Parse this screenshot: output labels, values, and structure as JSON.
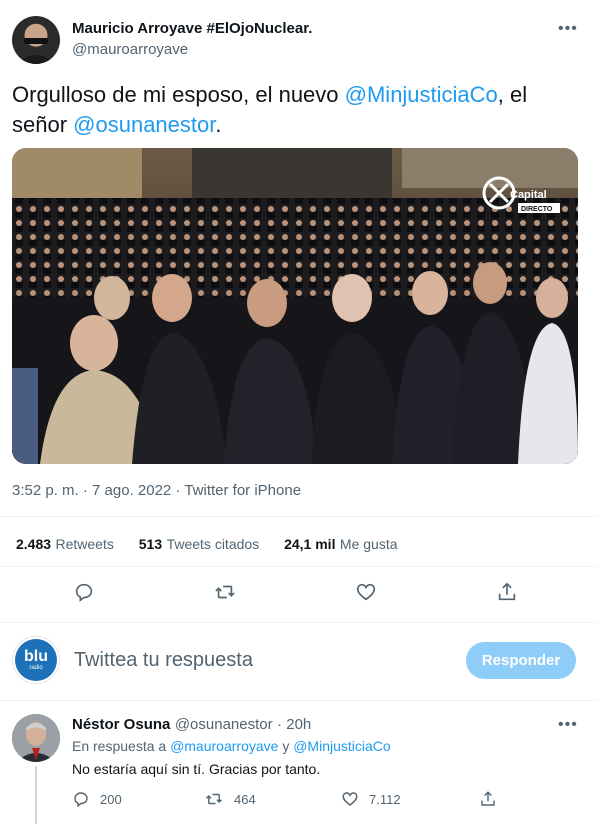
{
  "main_tweet": {
    "author_name": "Mauricio Arroyave #ElOjoNuclear.",
    "author_handle": "@mauroarroyave",
    "text_part1": "Orgulloso de mi esposo, el nuevo ",
    "mention1": "@MinjusticiaCo",
    "text_part2": ", el señor ",
    "mention2": "@osunanestor",
    "text_part3": ".",
    "image_logo_text": "Capital",
    "image_logo_sub": "DIRECTO",
    "timestamp": "3:52 p. m. · 7 ago. 2022 · Twitter for iPhone"
  },
  "stats": {
    "retweets_num": "2.483",
    "retweets_label": "Retweets",
    "quotes_num": "513",
    "quotes_label": "Tweets citados",
    "likes_num": "24,1 mil",
    "likes_label": "Me gusta"
  },
  "compose": {
    "avatar_text": "blu",
    "avatar_sub": "radio",
    "placeholder": "Twittea tu respuesta",
    "button_label": "Responder"
  },
  "reply": {
    "author_name": "Néstor Osuna",
    "author_handle": "@osunanestor",
    "time": "· 20h",
    "replying_to_prefix": "En respuesta a ",
    "replying_to_1": "@mauroarroyave",
    "replying_to_and": " y ",
    "replying_to_2": "@MinjusticiaCo",
    "text": "No estaría aquí sin tí. Gracias por tanto.",
    "reply_count": "200",
    "retweet_count": "464",
    "like_count": "7.112"
  },
  "colors": {
    "accent": "#1d9bf0",
    "button_disabled": "#8ecdf8",
    "secondary_text": "#536471",
    "divider": "#eff3f4"
  }
}
